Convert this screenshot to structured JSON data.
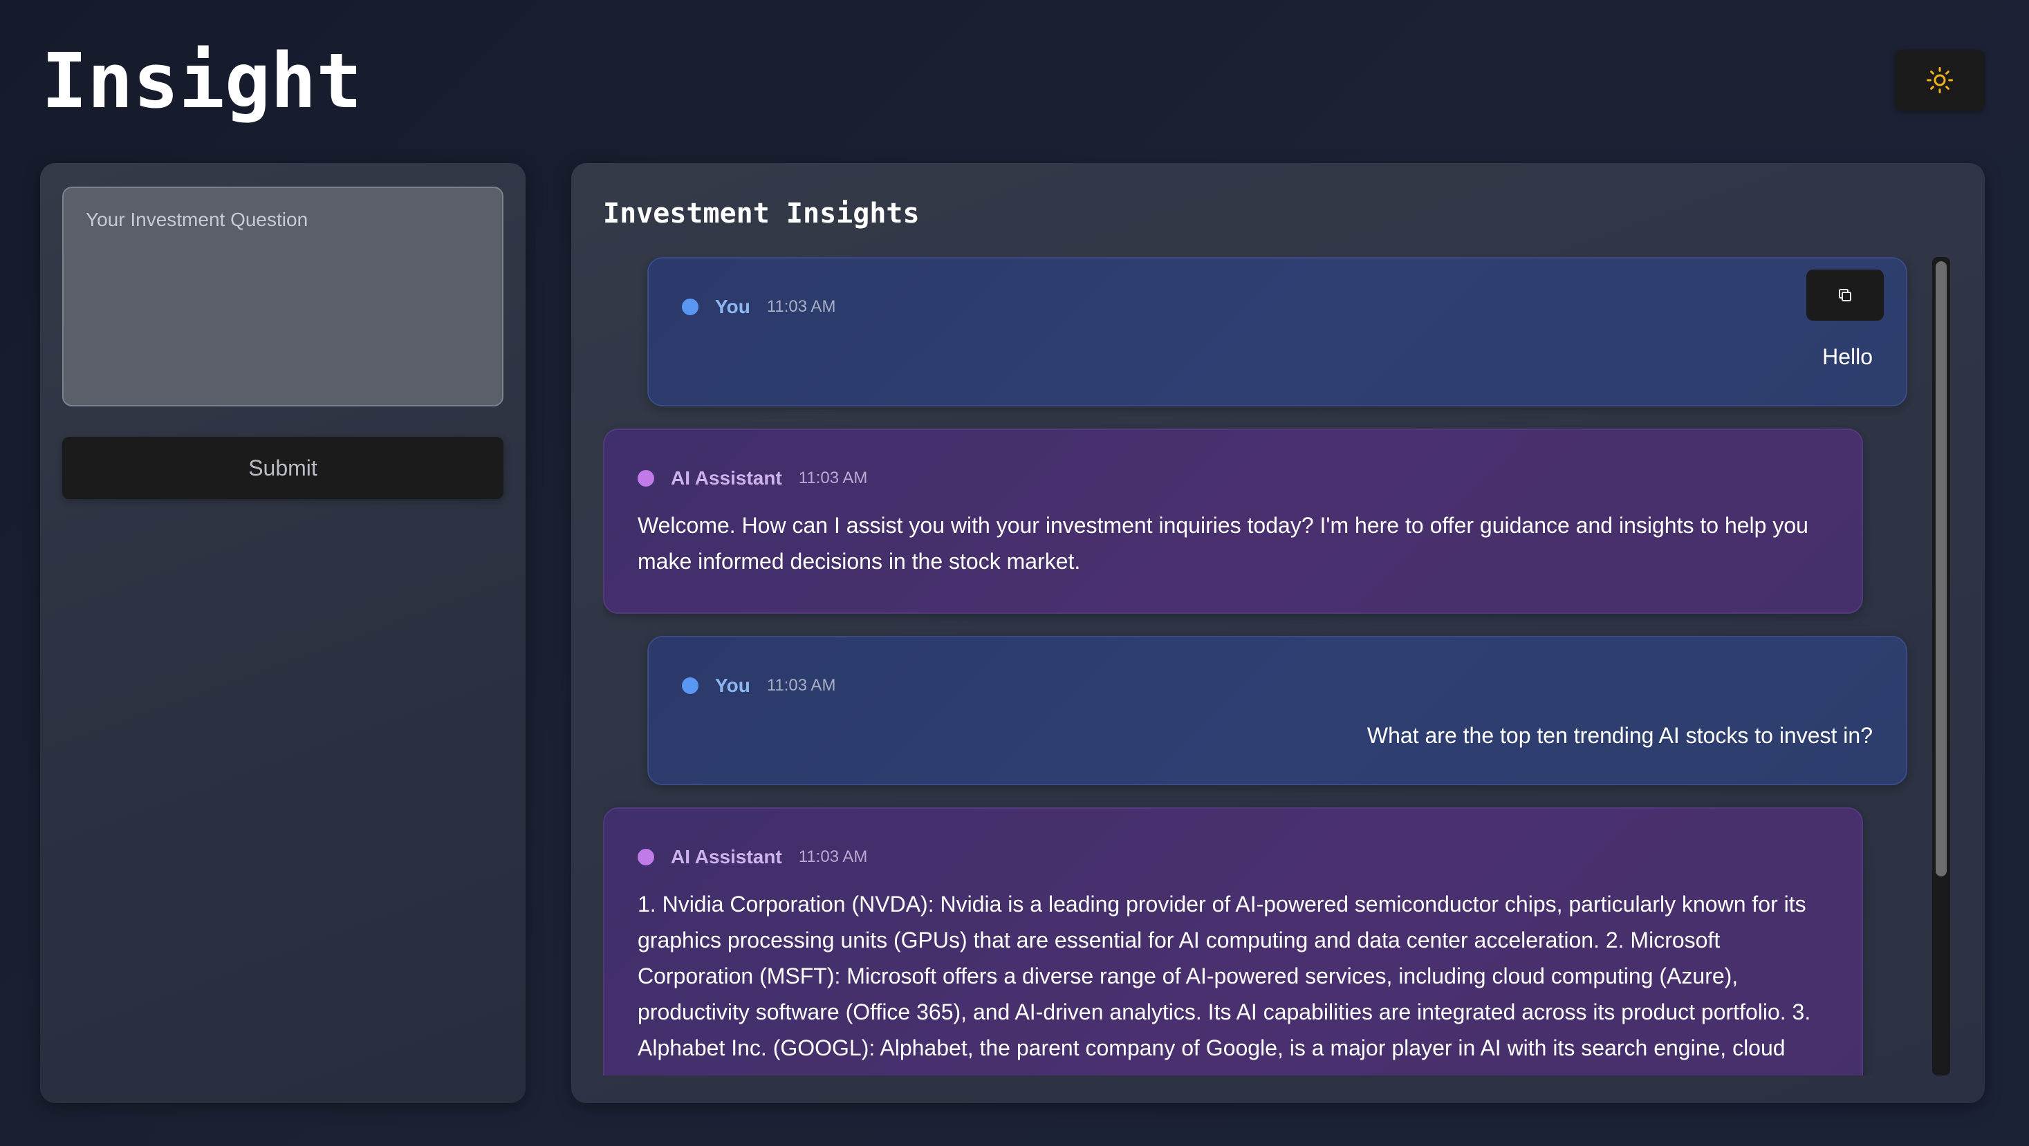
{
  "app": {
    "title": "Insight",
    "theme_icon": "sun-icon"
  },
  "colors": {
    "background": "#161c2c",
    "panel": "#2f3544",
    "user_bubble": "#2d3c6c",
    "ai_bubble": "#46306c",
    "user_dot": "#5a97f2",
    "ai_dot": "#c07be8",
    "sun": "#f2b21a"
  },
  "form": {
    "question_placeholder": "Your Investment Question",
    "question_value": "",
    "submit_label": "Submit"
  },
  "insights": {
    "title": "Investment Insights",
    "copy_icon": "copy-icon",
    "messages": [
      {
        "role": "user",
        "sender": "You",
        "time": "11:03 AM",
        "text": "Hello"
      },
      {
        "role": "ai",
        "sender": "AI Assistant",
        "time": "11:03 AM",
        "text": "Welcome. How can I assist you with your investment inquiries today? I'm here to offer guidance and insights to help you make informed decisions in the stock market."
      },
      {
        "role": "user",
        "sender": "You",
        "time": "11:03 AM",
        "text": "What are the top ten trending AI stocks to invest in?"
      },
      {
        "role": "ai",
        "sender": "AI Assistant",
        "time": "11:03 AM",
        "text": "1. Nvidia Corporation (NVDA): Nvidia is a leading provider of AI-powered semiconductor chips, particularly known for its graphics processing units (GPUs) that are essential for AI computing and data center acceleration. 2. Microsoft Corporation (MSFT): Microsoft offers a diverse range of AI-powered services, including cloud computing (Azure), productivity software (Office 365), and AI-driven analytics. Its AI capabilities are integrated across its product portfolio. 3. Alphabet Inc. (GOOGL): Alphabet, the parent company of Google, is a major player in AI with its search engine, cloud"
      }
    ]
  }
}
